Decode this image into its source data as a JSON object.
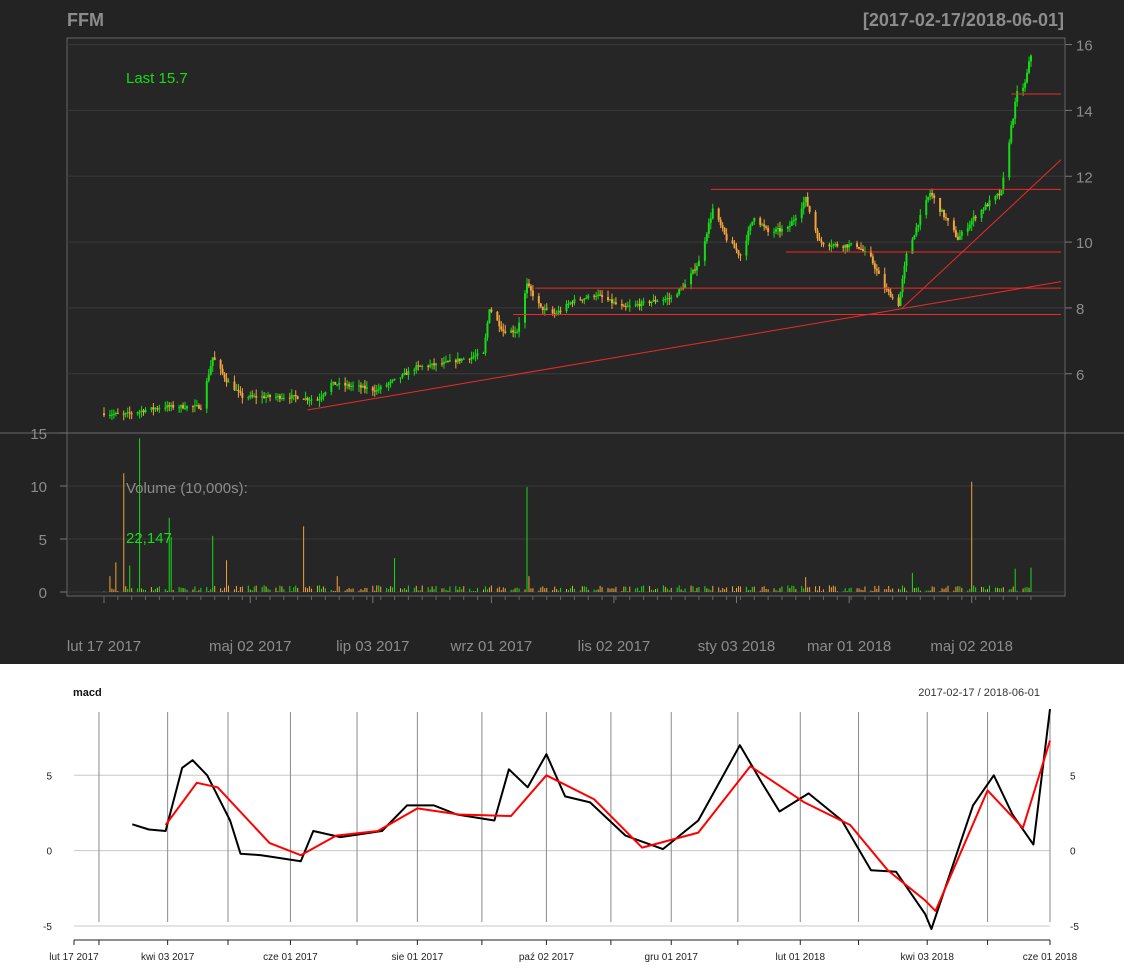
{
  "header": {
    "symbol": "FFM",
    "range": "[2017-02-17/2018-06-01]",
    "last_label": "Last 15.7",
    "volume_label": "Volume (10,000s):",
    "volume_value": "22,147"
  },
  "macd_panel": {
    "title": "macd",
    "range": "2017-02-17 / 2018-06-01"
  },
  "colors": {
    "up": "#16dc16",
    "down": "#f2a33a",
    "trendline": "#ee2a2a",
    "dark_bg": "#232323",
    "grid": "#3a3a3a",
    "text": "#8c8c8c",
    "macd": "#000000",
    "signal": "#ff0000"
  },
  "chart_data": [
    {
      "type": "candlestick",
      "x_range": [
        "2017-02-17",
        "2018-06-01"
      ],
      "ylim": [
        4.2,
        16.2
      ],
      "y_ticks": [
        "6",
        "8",
        "10",
        "12",
        "14",
        "16"
      ],
      "x_tick_labels": [
        "lut 17 2017",
        "maj 02 2017",
        "lip 03 2017",
        "wrz 01 2017",
        "lis 02 2017",
        "sty 03 2018",
        "mar 01 2018",
        "maj 02 2018"
      ],
      "last": 15.7,
      "close_series": [
        [
          "2017-02-17",
          4.8
        ],
        [
          "2017-02-27",
          4.75
        ],
        [
          "2017-03-10",
          4.9
        ],
        [
          "2017-03-20",
          5.0
        ],
        [
          "2017-03-30",
          5.0
        ],
        [
          "2017-04-07",
          5.0
        ],
        [
          "2017-04-13",
          6.5
        ],
        [
          "2017-04-20",
          5.8
        ],
        [
          "2017-04-28",
          5.3
        ],
        [
          "2017-05-10",
          5.3
        ],
        [
          "2017-05-25",
          5.3
        ],
        [
          "2017-06-05",
          5.2
        ],
        [
          "2017-06-12",
          5.7
        ],
        [
          "2017-06-26",
          5.6
        ],
        [
          "2017-07-05",
          5.5
        ],
        [
          "2017-07-17",
          5.9
        ],
        [
          "2017-07-25",
          6.2
        ],
        [
          "2017-08-07",
          6.3
        ],
        [
          "2017-08-21",
          6.5
        ],
        [
          "2017-08-28",
          6.6
        ],
        [
          "2017-08-31",
          8.0
        ],
        [
          "2017-09-07",
          7.3
        ],
        [
          "2017-09-14",
          7.3
        ],
        [
          "2017-09-19",
          8.7
        ],
        [
          "2017-09-26",
          8.0
        ],
        [
          "2017-10-03",
          7.8
        ],
        [
          "2017-10-12",
          8.2
        ],
        [
          "2017-10-24",
          8.4
        ],
        [
          "2017-11-07",
          8.0
        ],
        [
          "2017-11-21",
          8.2
        ],
        [
          "2017-12-01",
          8.3
        ],
        [
          "2017-12-08",
          8.7
        ],
        [
          "2017-12-15",
          9.4
        ],
        [
          "2017-12-22",
          11.0
        ],
        [
          "2017-12-29",
          10.1
        ],
        [
          "2018-01-05",
          9.6
        ],
        [
          "2018-01-12",
          10.8
        ],
        [
          "2018-01-19",
          10.3
        ],
        [
          "2018-01-29",
          10.4
        ],
        [
          "2018-02-07",
          11.3
        ],
        [
          "2018-02-14",
          10.0
        ],
        [
          "2018-02-23",
          9.9
        ],
        [
          "2018-03-05",
          9.9
        ],
        [
          "2018-03-12",
          9.5
        ],
        [
          "2018-03-19",
          8.6
        ],
        [
          "2018-03-26",
          8.1
        ],
        [
          "2018-03-30",
          9.6
        ],
        [
          "2018-04-05",
          10.6
        ],
        [
          "2018-04-11",
          11.5
        ],
        [
          "2018-04-18",
          10.8
        ],
        [
          "2018-04-25",
          10.1
        ],
        [
          "2018-05-04",
          10.8
        ],
        [
          "2018-05-11",
          11.2
        ],
        [
          "2018-05-17",
          11.5
        ],
        [
          "2018-05-22",
          13.5
        ],
        [
          "2018-05-25",
          14.5
        ],
        [
          "2018-05-29",
          14.8
        ],
        [
          "2018-06-01",
          15.7
        ]
      ],
      "horizontal_levels": [
        {
          "from": "2017-12-21",
          "to": "2018-06-01",
          "y": 11.6
        },
        {
          "from": "2018-01-28",
          "to": "2018-06-01",
          "y": 9.7
        },
        {
          "from": "2017-09-23",
          "to": "2018-06-01",
          "y": 8.6
        },
        {
          "from": "2017-09-12",
          "to": "2018-06-01",
          "y": 7.8
        },
        {
          "from": "2018-05-22",
          "to": "2018-06-01",
          "y": 14.5
        }
      ],
      "trendlines": [
        {
          "from": [
            "2017-05-31",
            4.9
          ],
          "to": [
            "2018-06-01",
            8.8
          ]
        },
        {
          "from": [
            "2018-03-28",
            8.0
          ],
          "to": [
            "2018-06-01",
            12.5
          ]
        }
      ]
    },
    {
      "type": "bar",
      "title": "Volume (10,000s):",
      "ylim": [
        0,
        15
      ],
      "y_ticks": [
        "0",
        "5",
        "10",
        "15"
      ],
      "last": "22,147",
      "spikes": [
        [
          "2017-02-20",
          1.5
        ],
        [
          "2017-02-23",
          2.8
        ],
        [
          "2017-02-27",
          11.2
        ],
        [
          "2017-03-02",
          2.5
        ],
        [
          "2017-03-07",
          14.5
        ],
        [
          "2017-03-22",
          7.0
        ],
        [
          "2017-03-23",
          5.2
        ],
        [
          "2017-04-13",
          5.3
        ],
        [
          "2017-04-20",
          3.0
        ],
        [
          "2017-05-29",
          6.2
        ],
        [
          "2017-06-15",
          1.5
        ],
        [
          "2017-07-14",
          3.2
        ],
        [
          "2017-09-19",
          9.9
        ],
        [
          "2017-09-20",
          1.5
        ],
        [
          "2018-02-07",
          1.4
        ],
        [
          "2018-04-02",
          1.8
        ],
        [
          "2018-05-02",
          10.4
        ],
        [
          "2018-05-24",
          2.2
        ],
        [
          "2018-06-01",
          2.3
        ]
      ],
      "baseline_typical": 0.35
    },
    {
      "type": "line",
      "title": "macd",
      "ylim": [
        -5.2,
        9.2
      ],
      "y_ticks": [
        "-5",
        "0",
        "5"
      ],
      "x_tick_labels": [
        "lut 17 2017",
        "kwi 03 2017",
        "cze 01 2017",
        "sie 01 2017",
        "paź 02 2017",
        "gru 01 2017",
        "lut 01 2018",
        "kwi 03 2018",
        "cze 01 2018"
      ],
      "series": [
        {
          "role": "macd",
          "points": [
            [
              "2017-03-17",
              1.75
            ],
            [
              "2017-03-25",
              1.4
            ],
            [
              "2017-04-02",
              1.3
            ],
            [
              "2017-04-10",
              5.5
            ],
            [
              "2017-04-15",
              6.0
            ],
            [
              "2017-04-22",
              5.0
            ],
            [
              "2017-05-03",
              2.0
            ],
            [
              "2017-05-08",
              -0.2
            ],
            [
              "2017-05-18",
              -0.3
            ],
            [
              "2017-06-06",
              -0.7
            ],
            [
              "2017-06-12",
              1.3
            ],
            [
              "2017-06-25",
              0.9
            ],
            [
              "2017-07-15",
              1.3
            ],
            [
              "2017-07-27",
              3.0
            ],
            [
              "2017-08-09",
              3.0
            ],
            [
              "2017-08-20",
              2.4
            ],
            [
              "2017-09-07",
              2.0
            ],
            [
              "2017-09-14",
              5.4
            ],
            [
              "2017-09-23",
              4.2
            ],
            [
              "2017-10-02",
              6.4
            ],
            [
              "2017-10-11",
              3.6
            ],
            [
              "2017-10-23",
              3.2
            ],
            [
              "2017-11-09",
              1.0
            ],
            [
              "2017-11-27",
              0.1
            ],
            [
              "2017-12-14",
              2.0
            ],
            [
              "2018-01-03",
              7.0
            ],
            [
              "2018-01-14",
              4.4
            ],
            [
              "2018-01-22",
              2.6
            ],
            [
              "2018-02-05",
              3.8
            ],
            [
              "2018-02-21",
              2.0
            ],
            [
              "2018-03-07",
              -1.3
            ],
            [
              "2018-03-19",
              -1.4
            ],
            [
              "2018-04-02",
              -4.2
            ],
            [
              "2018-04-05",
              -5.2
            ],
            [
              "2018-04-25",
              3.0
            ],
            [
              "2018-05-05",
              5.0
            ],
            [
              "2018-05-14",
              2.4
            ],
            [
              "2018-05-24",
              0.4
            ],
            [
              "2018-06-01",
              9.4
            ]
          ]
        },
        {
          "role": "signal",
          "points": [
            [
              "2017-04-02",
              1.7
            ],
            [
              "2017-04-17",
              4.5
            ],
            [
              "2017-04-27",
              4.2
            ],
            [
              "2017-05-22",
              0.5
            ],
            [
              "2017-06-06",
              -0.3
            ],
            [
              "2017-06-23",
              1.0
            ],
            [
              "2017-07-13",
              1.3
            ],
            [
              "2017-08-01",
              2.8
            ],
            [
              "2017-08-21",
              2.4
            ],
            [
              "2017-09-15",
              2.3
            ],
            [
              "2017-10-02",
              5.0
            ],
            [
              "2017-10-25",
              3.4
            ],
            [
              "2017-11-17",
              0.2
            ],
            [
              "2017-12-14",
              1.2
            ],
            [
              "2018-01-08",
              5.6
            ],
            [
              "2018-02-03",
              3.2
            ],
            [
              "2018-02-25",
              1.7
            ],
            [
              "2018-03-15",
              -1.3
            ],
            [
              "2018-04-02",
              -3.3
            ],
            [
              "2018-04-07",
              -4.0
            ],
            [
              "2018-05-02",
              4.0
            ],
            [
              "2018-05-19",
              1.5
            ],
            [
              "2018-06-01",
              7.3
            ]
          ]
        }
      ]
    }
  ]
}
